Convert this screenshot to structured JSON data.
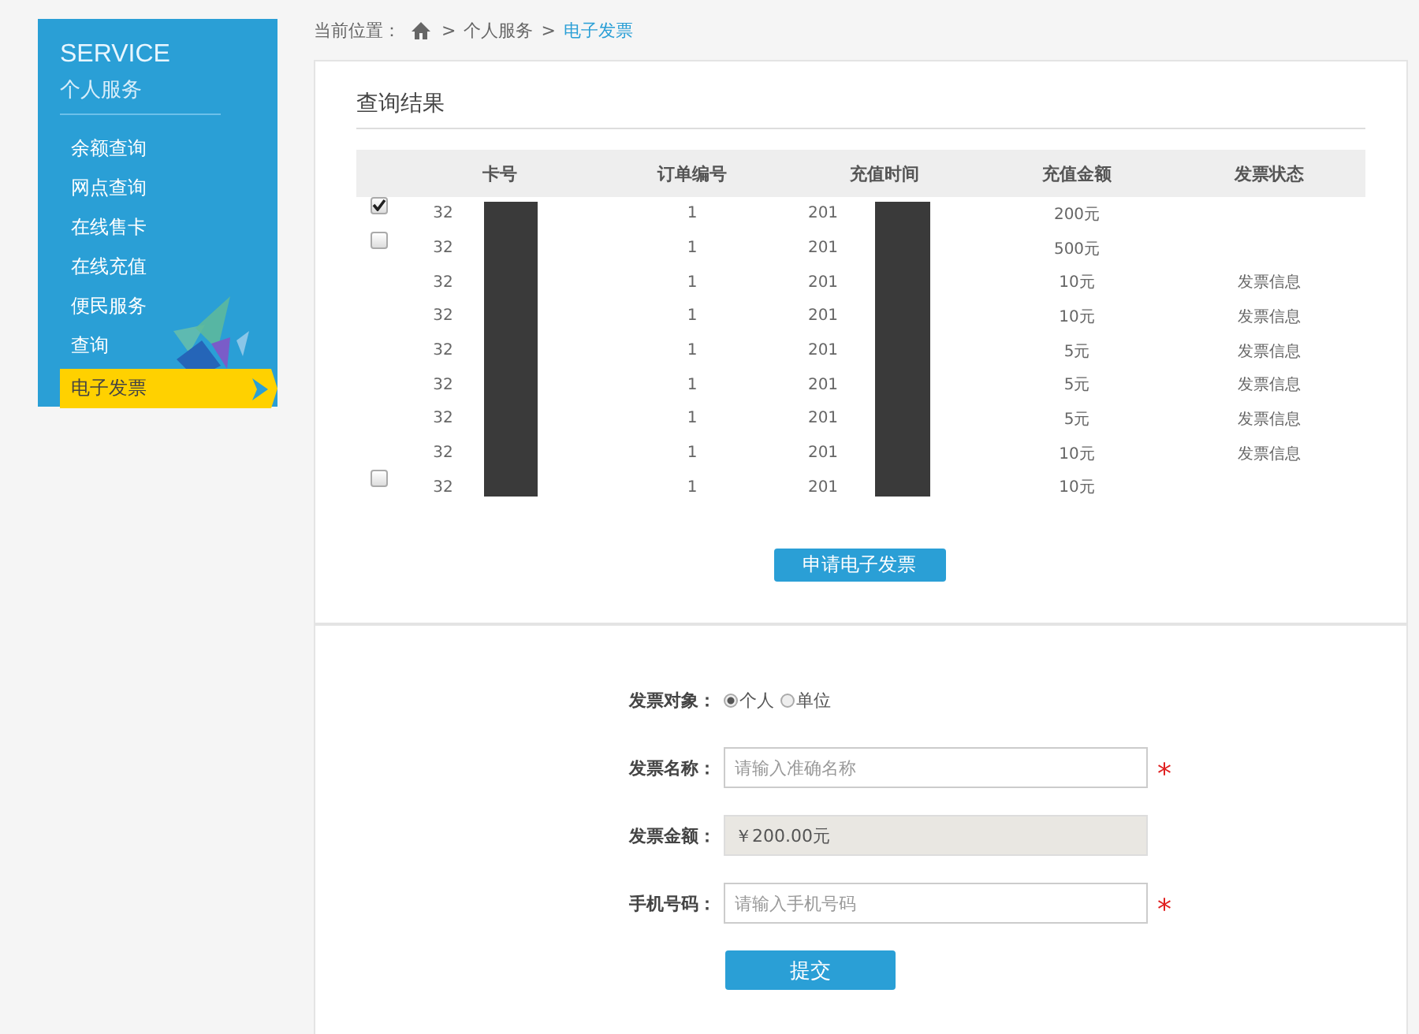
{
  "sidebar": {
    "title": "SERVICE",
    "subtitle": "个人服务",
    "items": [
      {
        "label": "余额查询",
        "selected": false
      },
      {
        "label": "网点查询",
        "selected": false
      },
      {
        "label": "在线售卡",
        "selected": false
      },
      {
        "label": "在线充值",
        "selected": false
      },
      {
        "label": "便民服务",
        "selected": false
      },
      {
        "label": "查询",
        "selected": false
      },
      {
        "label": "电子发票",
        "selected": true
      }
    ]
  },
  "breadcrumb": {
    "prefix": "当前位置：",
    "items": [
      {
        "label": "个人服务",
        "selected": false
      },
      {
        "label": "电子发票",
        "selected": true
      }
    ],
    "separator": ">"
  },
  "results": {
    "title": "查询结果",
    "table": {
      "columns": [
        "卡号",
        "订单编号",
        "充值时间",
        "充值金额",
        "发票状态"
      ],
      "rows": [
        {
          "checked": true,
          "card": "32",
          "order": "1",
          "time": "201",
          "amount": "200元"
        },
        {
          "checked": false,
          "card": "32",
          "order": "1",
          "time": "201",
          "amount": "500元"
        },
        {
          "card": "32",
          "order": "1",
          "time": "201",
          "amount": "10元",
          "status": "发票信息"
        },
        {
          "card": "32",
          "order": "1",
          "time": "201",
          "amount": "10元",
          "status": "发票信息"
        },
        {
          "card": "32",
          "order": "1",
          "time": "201",
          "amount": "5元",
          "status": "发票信息"
        },
        {
          "card": "32",
          "order": "1",
          "time": "201",
          "amount": "5元",
          "status": "发票信息"
        },
        {
          "card": "32",
          "order": "1",
          "time": "201",
          "amount": "5元",
          "status": "发票信息"
        },
        {
          "card": "32",
          "order": "1",
          "time": "201",
          "amount": "10元",
          "status": "发票信息"
        },
        {
          "checked": false,
          "card": "32",
          "order": "1",
          "time": "201",
          "amount": "10元"
        }
      ]
    },
    "button": "申请电子发票"
  },
  "form": {
    "fields": [
      {
        "kind": "radio",
        "label": "发票对象：",
        "options": [
          {
            "label": "个人",
            "selected": true
          },
          {
            "label": "单位",
            "selected": false
          }
        ]
      },
      {
        "kind": "input",
        "label": "发票名称：",
        "placeholder": "请输入准确名称",
        "required": "*"
      },
      {
        "kind": "readonly",
        "label": "发票金额：",
        "value": "￥200.00元"
      },
      {
        "kind": "input",
        "label": "手机号码：",
        "placeholder": "请输入手机号码",
        "required": "*"
      }
    ],
    "submit": "提交"
  }
}
